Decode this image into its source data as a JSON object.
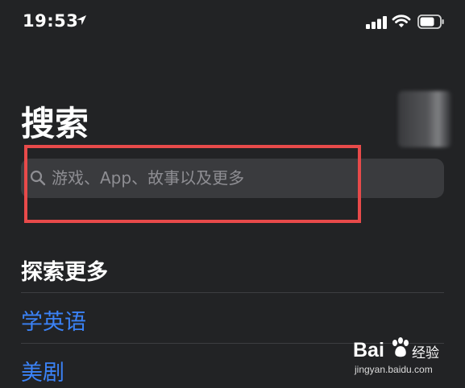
{
  "status_bar": {
    "time": "19:53"
  },
  "page": {
    "title": "搜索"
  },
  "search": {
    "placeholder": "游戏、App、故事以及更多"
  },
  "explore": {
    "title": "探索更多",
    "items": [
      {
        "label": "学英语"
      },
      {
        "label": "美剧"
      }
    ]
  },
  "watermark": {
    "brand_bai": "Bai",
    "brand_cn": "经验",
    "url": "jingyan.baidu.com"
  },
  "colors": {
    "background": "#222325",
    "search_bar": "#3a3b3e",
    "link": "#3b82f6",
    "highlight_border": "#e84a4a"
  }
}
